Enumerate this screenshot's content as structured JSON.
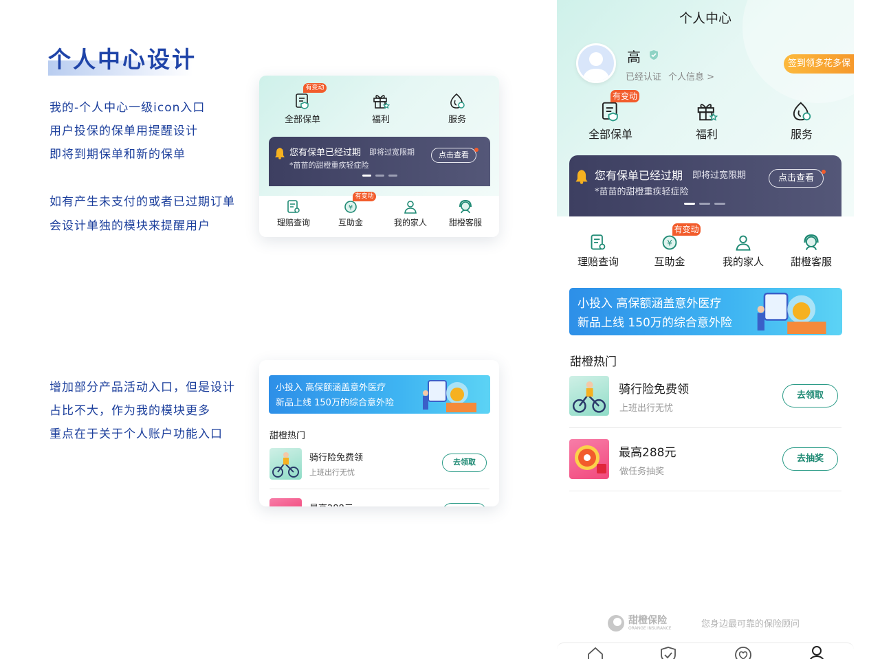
{
  "left": {
    "title": "个人中心设计",
    "notes1": [
      "我的-个人中心一级icon入口",
      "用户投保的保单用提醒设计",
      "即将到期保单和新的保单"
    ],
    "notes2": [
      "如有产生未支付的或者已过期订单",
      "会设计单独的模块来提醒用户"
    ],
    "notes3": [
      "增加部分产品活动入口，但是设计",
      "占比不大，作为我的模块更多",
      "重点在于关于个人账户功能入口"
    ]
  },
  "phone": {
    "header_title": "个人中心",
    "user_name": "高",
    "verified": "已经认证",
    "personal_info": "个人信息 >",
    "sign_badge": "签到领多花多保"
  },
  "top_icons": [
    {
      "label": "全部保单",
      "icon": "policy-icon",
      "tag": "有变动"
    },
    {
      "label": "福利",
      "icon": "gift-icon",
      "tag": ""
    },
    {
      "label": "服务",
      "icon": "service-icon",
      "tag": ""
    }
  ],
  "alert": {
    "title": "您有保单已经过期",
    "sub": "即将过宽限期",
    "product": "*苗苗的甜橙重疾轻症险",
    "button": "点击查看"
  },
  "sub_icons": [
    {
      "label": "理赔查询",
      "icon": "claim-icon",
      "tag": ""
    },
    {
      "label": "互助金",
      "icon": "fund-icon",
      "tag": "有变动"
    },
    {
      "label": "我的家人",
      "icon": "family-icon",
      "tag": ""
    },
    {
      "label": "甜橙客服",
      "icon": "support-icon",
      "tag": ""
    }
  ],
  "promo": {
    "line1": "小投入  高保额涵盖意外医疗",
    "line2": "新品上线 150万的综合意外险"
  },
  "hot": {
    "title": "甜橙热门",
    "items": [
      {
        "title": "骑行险免费领",
        "sub": "上班出行无忧",
        "button": "去领取"
      },
      {
        "title": "最高288元",
        "sub": "做任务抽奖",
        "button": "去抽奖"
      }
    ]
  },
  "footer": {
    "brand": "甜橙保险",
    "brand_en": "ORANGE INSURANCE",
    "slogan": "您身边最可靠的保险顾问"
  },
  "colors": {
    "accent": "#2a9b87",
    "tag": "#f25c2c",
    "note": "#1c3f9c",
    "banner": "#45476a"
  }
}
